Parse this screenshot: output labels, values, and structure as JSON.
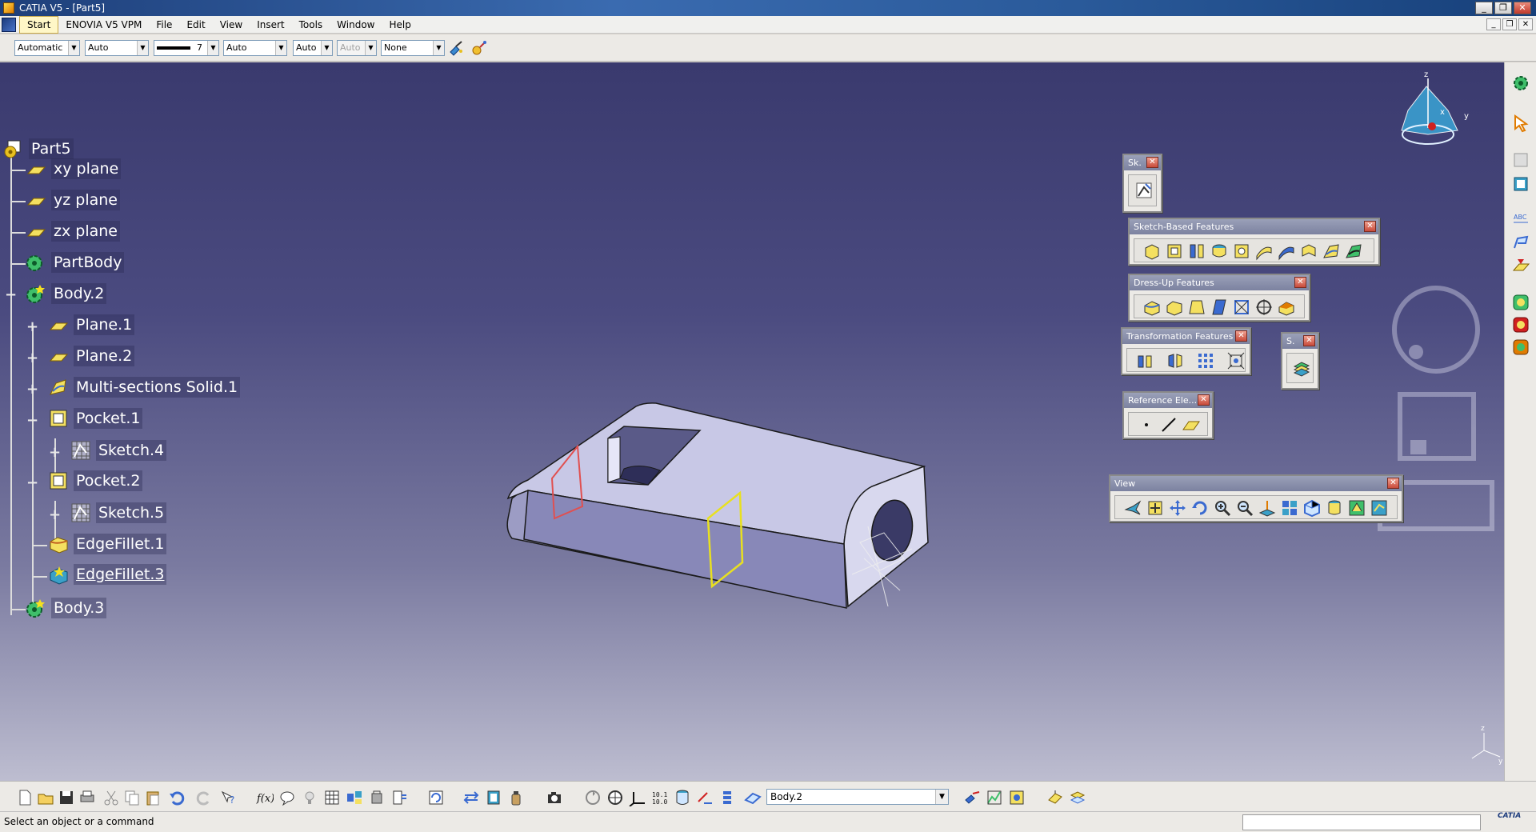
{
  "window": {
    "title": "CATIA V5 - [Part5]"
  },
  "menu": {
    "items": [
      "Start",
      "ENOVIA V5 VPM",
      "File",
      "Edit",
      "View",
      "Insert",
      "Tools",
      "Window",
      "Help"
    ]
  },
  "properties": {
    "color": "Automatic",
    "transparency": "Auto",
    "line_weight": "7",
    "line_type": "Auto",
    "point_symbol": "Auto",
    "render_style": "Auto",
    "layer": "None"
  },
  "tree": {
    "root": "Part5",
    "items": [
      {
        "label": "xy plane"
      },
      {
        "label": "yz plane"
      },
      {
        "label": "zx plane"
      },
      {
        "label": "PartBody"
      },
      {
        "label": "Body.2"
      },
      {
        "label": "Plane.1"
      },
      {
        "label": "Plane.2"
      },
      {
        "label": "Multi-sections Solid.1"
      },
      {
        "label": "Pocket.1"
      },
      {
        "label": "Sketch.4"
      },
      {
        "label": "Pocket.2"
      },
      {
        "label": "Sketch.5"
      },
      {
        "label": "EdgeFillet.1"
      },
      {
        "label": "EdgeFillet.3"
      },
      {
        "label": "Body.3"
      }
    ]
  },
  "toolbars": {
    "sketcher": "Sk.",
    "sketch_based": "Sketch-Based Features",
    "dress_up": "Dress-Up Features",
    "transformation": "Transformation Features",
    "surface": "S.",
    "reference": "Reference Ele...",
    "view": "View"
  },
  "compass_axes": {
    "x": "x",
    "y": "y",
    "z": "z"
  },
  "bottom": {
    "active_body": "Body.2"
  },
  "status": {
    "message": "Select an object or a command"
  },
  "brand": "CATIA",
  "colors": {
    "viewport_top": "#3a3a6e",
    "viewport_bottom": "#bdbdd0",
    "part_face": "#c8c8e6",
    "plane_red": "#e05050",
    "plane_yellow": "#e8e020"
  }
}
